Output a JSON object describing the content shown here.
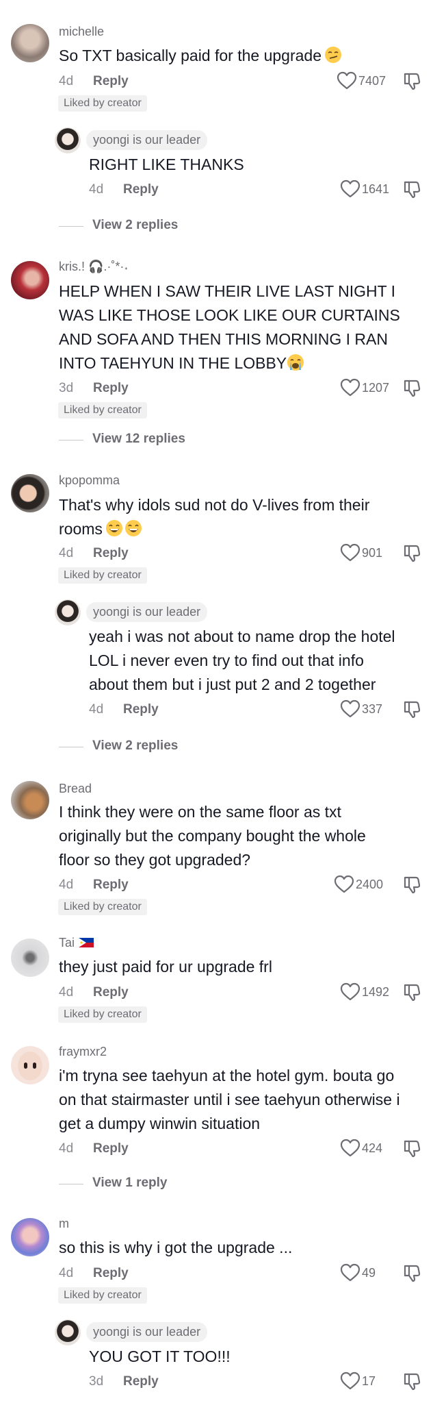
{
  "comments": [
    {
      "username": "michelle",
      "text": "So TXT basically paid for the upgrade",
      "time": "4d",
      "reply_label": "Reply",
      "likes": "7407",
      "badge": "Liked by creator"
    },
    {
      "username": "yoongi is our leader",
      "text": "RIGHT LIKE THANKS",
      "time": "4d",
      "reply_label": "Reply",
      "likes": "1641",
      "view_replies": "View 2 replies"
    },
    {
      "username": "kris.!",
      "username_deco": "🎧.·˚*·˖",
      "text_lines": [
        "HELP WHEN I SAW THEIR LIVE LAST NIGHT I",
        "WAS LIKE THOSE LOOK LIKE OUR CURTAINS",
        "AND SOFA AND THEN THIS MORNING I RAN",
        "INTO TAEHYUN IN THE LOBBY"
      ],
      "time": "3d",
      "reply_label": "Reply",
      "likes": "1207",
      "badge": "Liked by creator",
      "view_replies": "View 12 replies"
    },
    {
      "username": "kpopomma",
      "text_lines": [
        "That's why idols sud not do V-lives from their",
        "rooms"
      ],
      "time": "4d",
      "reply_label": "Reply",
      "likes": "901",
      "badge": "Liked by creator"
    },
    {
      "username": "yoongi is our leader",
      "text_lines": [
        "yeah i was not about to name drop the hotel",
        "LOL i never even try to find out that info",
        "about them but i just put 2 and 2 together"
      ],
      "time": "4d",
      "reply_label": "Reply",
      "likes": "337",
      "view_replies": "View 2 replies"
    },
    {
      "username": "Bread",
      "text_lines": [
        "I think they were on the same floor as txt",
        "originally but the company bought the whole",
        "floor so they got upgraded?"
      ],
      "time": "4d",
      "reply_label": "Reply",
      "likes": "2400",
      "badge": "Liked by creator"
    },
    {
      "username": "Tai",
      "text": "they just paid for ur upgrade frl",
      "time": "4d",
      "reply_label": "Reply",
      "likes": "1492",
      "badge": "Liked by creator"
    },
    {
      "username": "fraymxr2",
      "text_lines": [
        "i'm tryna see taehyun at the hotel gym. bouta go",
        "on that stairmaster until i see taehyun otherwise i",
        "get a dumpy winwin situation"
      ],
      "time": "4d",
      "reply_label": "Reply",
      "likes": "424",
      "view_replies": "View 1 reply"
    },
    {
      "username": "m",
      "text": "so this is why i got the upgrade ...",
      "time": "4d",
      "reply_label": "Reply",
      "likes": "49",
      "badge": "Liked by creator"
    },
    {
      "username": "yoongi is our leader",
      "text": "YOU GOT IT TOO!!!",
      "time": "3d",
      "reply_label": "Reply",
      "likes": "17"
    }
  ],
  "icons": {
    "like": "heart-outline-icon",
    "dislike": "thumbs-down-icon"
  },
  "colors": {
    "text": "#161823",
    "muted": "#8a8b91",
    "badge_bg": "#f1f1f2"
  }
}
